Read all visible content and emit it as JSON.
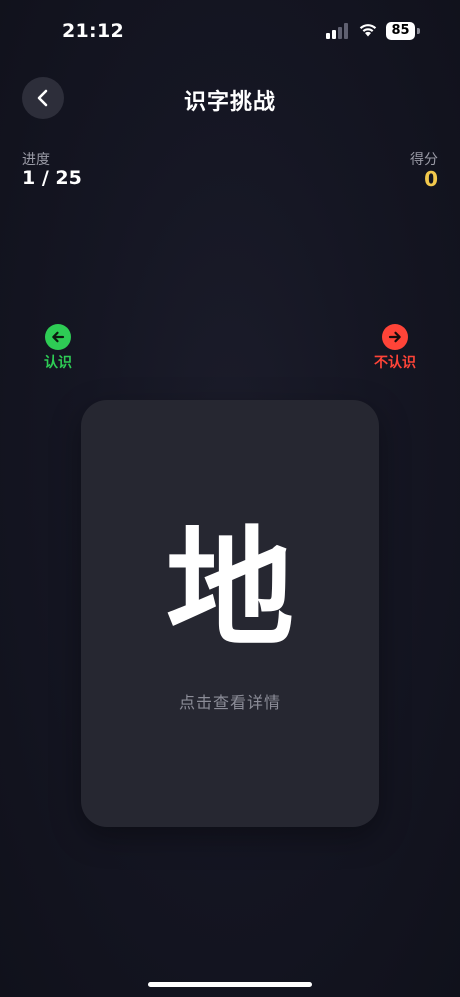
{
  "status_bar": {
    "time": "21:12",
    "battery": "85",
    "icons": [
      "signal-icon",
      "wifi-icon",
      "battery-icon"
    ]
  },
  "header": {
    "title": "识字挑战",
    "back_icon": "chevron-left-icon"
  },
  "stats": {
    "progress_label": "进度",
    "progress_value": "1 / 25",
    "score_label": "得分",
    "score_value": "0"
  },
  "swipe_hints": {
    "left": {
      "label": "认识",
      "icon": "arrow-left-icon",
      "color": "#2ecc55"
    },
    "right": {
      "label": "不认识",
      "icon": "arrow-right-icon",
      "color": "#ff4438"
    }
  },
  "card": {
    "character": "地",
    "hint": "点击查看详情"
  },
  "colors": {
    "background": "#151623",
    "card": "#262731",
    "score": "#f2c94c"
  }
}
